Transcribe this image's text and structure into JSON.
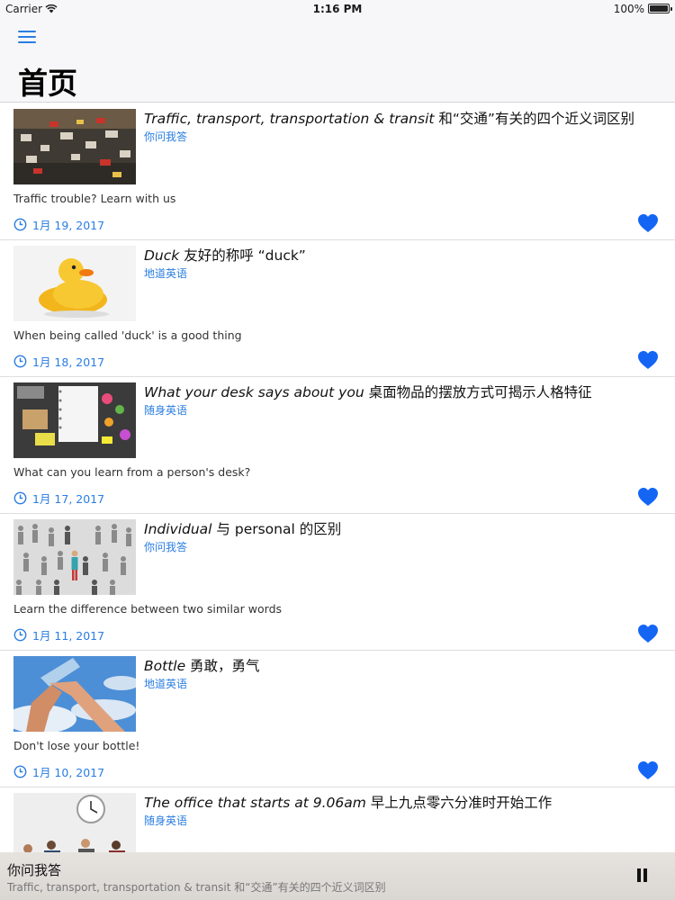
{
  "status_bar": {
    "carrier": "Carrier",
    "time": "1:16 PM",
    "battery": "100%"
  },
  "nav": {
    "title": "首页",
    "menu_icon": "hamburger-menu-icon"
  },
  "articles": [
    {
      "title_en": "Traffic, transport, transportation & transit",
      "title_zh": " 和“交通”有关的四个近义词区别",
      "category": "你问我答",
      "summary": "Traffic trouble? Learn with us",
      "date": "1月 19, 2017"
    },
    {
      "title_en": "Duck",
      "title_zh": " 友好的称呼 “duck”",
      "category": "地道英语",
      "summary": "When being called 'duck' is a good thing",
      "date": "1月 18, 2017"
    },
    {
      "title_en": "What your desk says about you",
      "title_zh": " 桌面物品的摆放方式可揭示人格特征",
      "category": "随身英语",
      "summary": "What can you learn from a person's desk?",
      "date": "1月 17, 2017"
    },
    {
      "title_en": "Individual",
      "title_zh": " 与 personal 的区别",
      "category": "你问我答",
      "summary": "Learn the difference between two similar words",
      "date": "1月 11, 2017"
    },
    {
      "title_en": "Bottle",
      "title_zh": " 勇敢，勇气",
      "category": "地道英语",
      "summary": "Don't lose your bottle!",
      "date": "1月 10, 2017"
    },
    {
      "title_en": "The office that starts at 9.06am",
      "title_zh": " 早上九点零六分准时开始工作",
      "category": "随身英语",
      "summary": "",
      "date": ""
    }
  ],
  "player": {
    "title": "你问我答",
    "subtitle": "Traffic, transport, transportation & transit 和“交通”有关的四个近义词区别",
    "state": "playing"
  },
  "colors": {
    "accent": "#2a7de1",
    "heart": "#1565f5",
    "nav_bg": "#f7f7f9"
  }
}
